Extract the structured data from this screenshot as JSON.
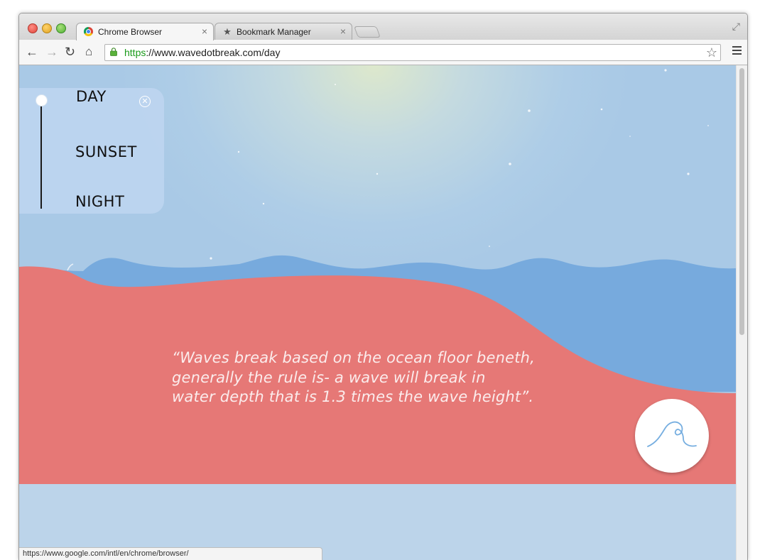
{
  "browser": {
    "tabs": [
      {
        "label": "Chrome Browser",
        "active": true
      },
      {
        "label": "Bookmark Manager",
        "active": false
      }
    ],
    "url_scheme": "https",
    "url_rest": "://www.wavedotbreak.com/day",
    "status_url": "https://www.google.com/intl/en/chrome/browser/"
  },
  "page": {
    "time_options": [
      "DAY",
      "SUNSET",
      "NIGHT"
    ],
    "selected_time": "DAY",
    "quote_lines": [
      "“Waves break based on the ocean floor beneth,",
      "generally the rule is- a wave will break in",
      "water depth  that is 1.3 times the wave height”."
    ]
  },
  "colors": {
    "sky": "#aecde7",
    "sea": "#77aadd",
    "sand": "#e67876",
    "ground": "#bcd4ea",
    "accent_wave_icon": "#76aee0"
  }
}
